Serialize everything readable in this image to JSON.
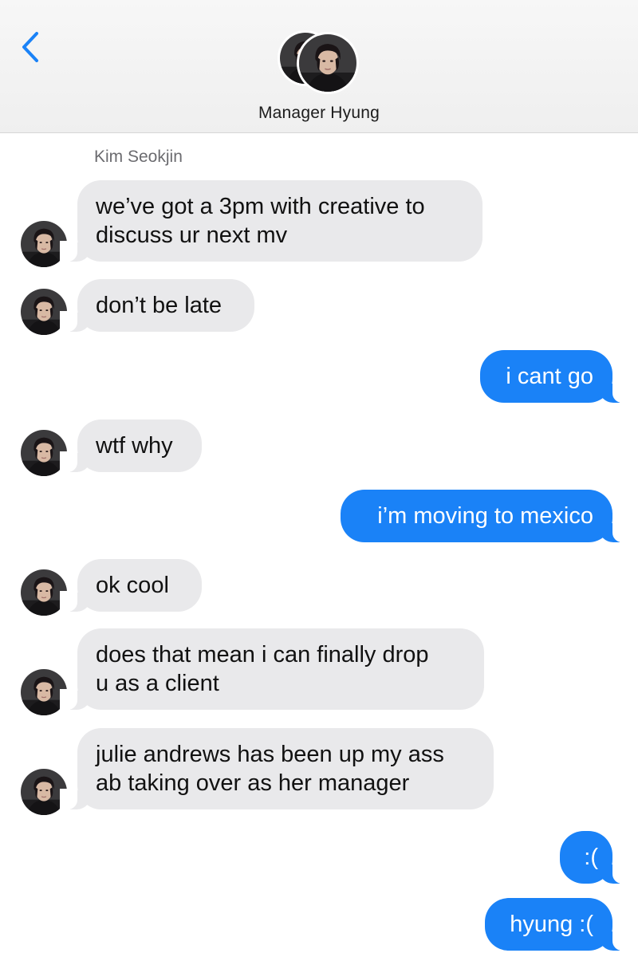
{
  "header": {
    "title": "Manager Hyung",
    "back_icon": "chevron-left-icon",
    "accent_color": "#1a82f7"
  },
  "conversation": {
    "sender_name": "Kim Seokjin",
    "incoming_bubble_color": "#e9e9eb",
    "outgoing_bubble_color": "#1a82f7",
    "messages": [
      {
        "from": "them",
        "text_lines": [
          "we’ve got a 3pm with creative to",
          "discuss ur next mv"
        ]
      },
      {
        "from": "them",
        "text_lines": [
          "don’t be late"
        ]
      },
      {
        "from": "me",
        "text_lines": [
          "i cant go"
        ]
      },
      {
        "from": "them",
        "text_lines": [
          "wtf why"
        ]
      },
      {
        "from": "me",
        "text_lines": [
          "i’m moving to mexico"
        ]
      },
      {
        "from": "them",
        "text_lines": [
          "ok cool"
        ]
      },
      {
        "from": "them",
        "text_lines": [
          "does that mean i can finally drop",
          "u as a client"
        ]
      },
      {
        "from": "them",
        "text_lines": [
          "julie andrews has been up my ass",
          "ab taking over as her manager"
        ]
      },
      {
        "from": "me",
        "text_lines": [
          ":("
        ]
      },
      {
        "from": "me",
        "text_lines": [
          "hyung :("
        ]
      }
    ]
  }
}
